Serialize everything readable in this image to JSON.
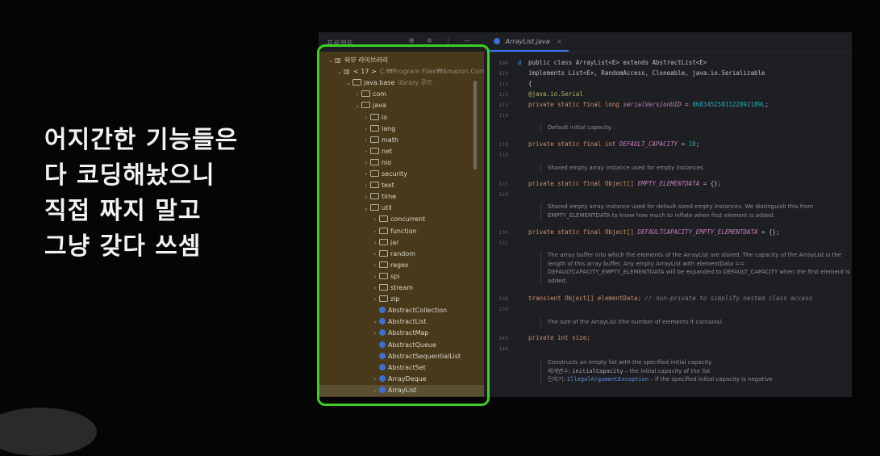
{
  "caption": {
    "lines": [
      "어지간한 기능들은",
      "다 코딩해놨으니",
      "직접 짜지 말고",
      "그냥 갖다 쓰셈"
    ]
  },
  "project_panel": {
    "title": "프로젝트",
    "title_suffix": "⌄",
    "toolbar": "⊕ ≑ ⋮ —"
  },
  "tree": [
    {
      "indent": 0,
      "chev": "v",
      "icon": "library",
      "label": "외부 라이브러리"
    },
    {
      "indent": 1,
      "chev": "v",
      "icon": "library",
      "label": "< 17 >",
      "extra": "C:₩Program Files₩Amazon Corr"
    },
    {
      "indent": 2,
      "chev": "v",
      "icon": "folder",
      "label": "java.base",
      "extra": "library 루트"
    },
    {
      "indent": 3,
      "chev": ">",
      "icon": "folder",
      "label": "com"
    },
    {
      "indent": 3,
      "chev": "v",
      "icon": "folder",
      "label": "java"
    },
    {
      "indent": 4,
      "chev": ">",
      "icon": "folder",
      "label": "io"
    },
    {
      "indent": 4,
      "chev": ">",
      "icon": "folder",
      "label": "lang"
    },
    {
      "indent": 4,
      "chev": ">",
      "icon": "folder",
      "label": "math"
    },
    {
      "indent": 4,
      "chev": ">",
      "icon": "folder",
      "label": "net"
    },
    {
      "indent": 4,
      "chev": ">",
      "icon": "folder",
      "label": "nio"
    },
    {
      "indent": 4,
      "chev": ">",
      "icon": "folder",
      "label": "security"
    },
    {
      "indent": 4,
      "chev": ">",
      "icon": "folder",
      "label": "text"
    },
    {
      "indent": 4,
      "chev": ">",
      "icon": "folder",
      "label": "time"
    },
    {
      "indent": 4,
      "chev": "v",
      "icon": "folder",
      "label": "util"
    },
    {
      "indent": 5,
      "chev": ">",
      "icon": "folder",
      "label": "concurrent"
    },
    {
      "indent": 5,
      "chev": ">",
      "icon": "folder",
      "label": "function"
    },
    {
      "indent": 5,
      "chev": ">",
      "icon": "folder",
      "label": "jar"
    },
    {
      "indent": 5,
      "chev": ">",
      "icon": "folder",
      "label": "random"
    },
    {
      "indent": 5,
      "chev": ">",
      "icon": "folder",
      "label": "regex"
    },
    {
      "indent": 5,
      "chev": ">",
      "icon": "folder",
      "label": "spi"
    },
    {
      "indent": 5,
      "chev": ">",
      "icon": "folder",
      "label": "stream"
    },
    {
      "indent": 5,
      "chev": ">",
      "icon": "folder",
      "label": "zip"
    },
    {
      "indent": 5,
      "chev": "",
      "icon": "class",
      "label": "AbstractCollection"
    },
    {
      "indent": 5,
      "chev": ">",
      "icon": "class",
      "label": "AbstractList"
    },
    {
      "indent": 5,
      "chev": ">",
      "icon": "class",
      "label": "AbstractMap"
    },
    {
      "indent": 5,
      "chev": "",
      "icon": "class",
      "label": "AbstractQueue"
    },
    {
      "indent": 5,
      "chev": "",
      "icon": "class",
      "label": "AbstractSequentialList"
    },
    {
      "indent": 5,
      "chev": "",
      "icon": "class",
      "label": "AbstractSet"
    },
    {
      "indent": 5,
      "chev": ">",
      "icon": "class",
      "label": "ArrayDeque"
    },
    {
      "indent": 5,
      "chev": ">",
      "icon": "class",
      "label": "ArrayList",
      "selected": true
    }
  ],
  "editor": {
    "tab_label": "ArrayList.java",
    "tab_close": "×",
    "line_numbers": {
      "l109": "109",
      "l110": "110",
      "l111": "111",
      "l112": "112",
      "l113": "113",
      "l114": "114",
      "l118": "118",
      "l119": "119",
      "l123": "123",
      "l124": "124",
      "l130": "130",
      "l131": "131",
      "l138": "138",
      "l139": "139",
      "l145": "145",
      "l146": "146"
    },
    "at_sign": "@",
    "code": {
      "c109": "public class ArrayList<E> extends AbstractList<E>",
      "c110": "        implements List<E>, RandomAccess, Cloneable, java.io.Serializable",
      "c111": "{",
      "c112": "    @java.io.Serial",
      "c113a": "    private static final long ",
      "c113b": "serialVersionUID",
      "c113c": " = ",
      "c113d": "8683452581122892189L",
      "c113e": ";",
      "c118a": "    private static final int ",
      "c118b": "DEFAULT_CAPACITY",
      "c118c": " = ",
      "c118d": "10",
      "c118e": ";",
      "c123a": "    private static final Object[] ",
      "c123b": "EMPTY_ELEMENTDATA",
      "c123c": " = {};",
      "c130a": "    private static final Object[] ",
      "c130b": "DEFAULTCAPACITY_EMPTY_ELEMENTDATA",
      "c130c": " = {};",
      "c138a": "    transient Object[] elementData; ",
      "c138b": "// non-private to simplify nested class access",
      "c145a": "    private int size;"
    },
    "docs": {
      "d1": "Default initial capacity.",
      "d2": "Shared empty array instance used for empty instances.",
      "d3": "Shared empty array instance used for default sized empty instances. We distinguish this from EMPTY_ELEMENTDATA to know how much to inflate when first element is added.",
      "d4": "The array buffer into which the elements of the ArrayList are stored. The capacity of the ArrayList is the length of this array buffer. Any empty ArrayList with elementData == DEFAULTCAPACITY_EMPTY_ELEMENTDATA will be expanded to DEFAULT_CAPACITY when the first element is added.",
      "d5": "The size of the ArrayList (the number of elements it contains).",
      "d6a": "Constructs an empty list with the specified initial capacity.",
      "d6b_label": "매개변수: ",
      "d6b_name": "initialCapacity",
      "d6b_text": " – the initial capacity of the list",
      "d6c_label": "던지기: ",
      "d6c_name": "IllegalArgumentException",
      "d6c_text": " – if the specified initial capacity is negative"
    }
  },
  "colors": {
    "highlight": "#3ecf25",
    "tree_bg": "#48391a",
    "editor_bg": "#1e1f22",
    "keyword": "#cf8e6d",
    "constant": "#c77dbb",
    "number": "#2aacb8"
  }
}
